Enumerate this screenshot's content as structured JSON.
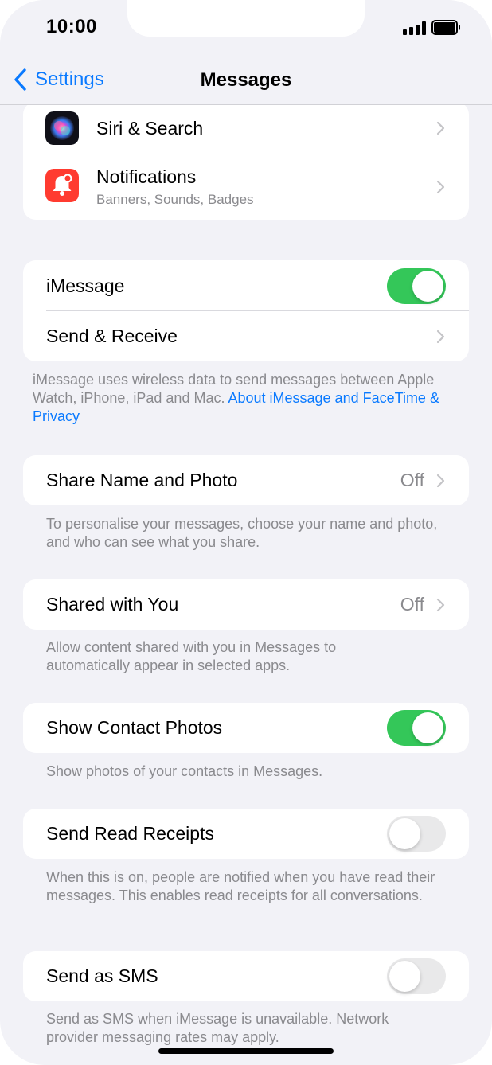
{
  "status_bar": {
    "time": "10:00"
  },
  "nav": {
    "back_label": "Settings",
    "title": "Messages"
  },
  "group_top": {
    "siri": {
      "label": "Siri & Search"
    },
    "notifications": {
      "label": "Notifications",
      "subtitle": "Banners, Sounds, Badges"
    }
  },
  "imessage_group": {
    "imessage": {
      "label": "iMessage",
      "enabled": true
    },
    "send_receive": {
      "label": "Send & Receive"
    },
    "footnote": "iMessage uses wireless data to send messages between Apple Watch, iPhone, iPad and Mac.",
    "footnote_link": "About iMessage and FaceTime & Privacy"
  },
  "share_name": {
    "label": "Share Name and Photo",
    "value": "Off",
    "footnote": "To personalise your messages, choose your name and photo, and who can see what you share."
  },
  "shared_with_you": {
    "label": "Shared with You",
    "value": "Off",
    "footnote": "Allow content shared with you in Messages to automatically appear in selected apps."
  },
  "contact_photos": {
    "label": "Show Contact Photos",
    "enabled": true,
    "footnote": "Show photos of your contacts in Messages."
  },
  "read_receipts": {
    "label": "Send Read Receipts",
    "enabled": false,
    "footnote": "When this is on, people are notified when you have read their messages. This enables read receipts for all conversations."
  },
  "send_sms": {
    "label": "Send as SMS",
    "enabled": false,
    "footnote": "Send as SMS when iMessage is unavailable. Network provider messaging rates may apply."
  },
  "colors": {
    "accent": "#0a7aff",
    "toggle_on": "#34c759",
    "notifications_icon": "#ff3b30"
  },
  "icons": {
    "siri": "siri-icon",
    "notifications": "bell-icon"
  }
}
